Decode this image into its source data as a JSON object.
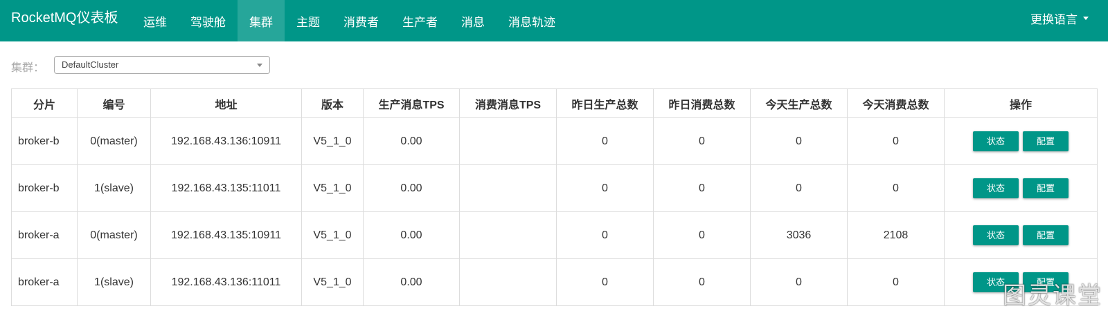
{
  "navbar": {
    "brand": "RocketMQ仪表板",
    "items": [
      {
        "label": "运维",
        "active": false
      },
      {
        "label": "驾驶舱",
        "active": false
      },
      {
        "label": "集群",
        "active": true
      },
      {
        "label": "主题",
        "active": false
      },
      {
        "label": "消费者",
        "active": false
      },
      {
        "label": "生产者",
        "active": false
      },
      {
        "label": "消息",
        "active": false
      },
      {
        "label": "消息轨迹",
        "active": false
      }
    ],
    "language": "更换语言"
  },
  "cluster": {
    "label": "集群：",
    "selected": "DefaultCluster"
  },
  "table": {
    "headers": [
      "分片",
      "编号",
      "地址",
      "版本",
      "生产消息TPS",
      "消费消息TPS",
      "昨日生产总数",
      "昨日消费总数",
      "今天生产总数",
      "今天消费总数",
      "操作"
    ],
    "rows": [
      {
        "name": "broker-b",
        "id": "0(master)",
        "address": "192.168.43.136:10911",
        "version": "V5_1_0",
        "produce_tps": "0.00",
        "consume_tps": "",
        "yesterday_produce": "0",
        "yesterday_consume": "0",
        "today_produce": "0",
        "today_consume": "0"
      },
      {
        "name": "broker-b",
        "id": "1(slave)",
        "address": "192.168.43.135:11011",
        "version": "V5_1_0",
        "produce_tps": "0.00",
        "consume_tps": "",
        "yesterday_produce": "0",
        "yesterday_consume": "0",
        "today_produce": "0",
        "today_consume": "0"
      },
      {
        "name": "broker-a",
        "id": "0(master)",
        "address": "192.168.43.135:10911",
        "version": "V5_1_0",
        "produce_tps": "0.00",
        "consume_tps": "",
        "yesterday_produce": "0",
        "yesterday_consume": "0",
        "today_produce": "3036",
        "today_consume": "2108"
      },
      {
        "name": "broker-a",
        "id": "1(slave)",
        "address": "192.168.43.136:11011",
        "version": "V5_1_0",
        "produce_tps": "0.00",
        "consume_tps": "",
        "yesterday_produce": "0",
        "yesterday_consume": "0",
        "today_produce": "0",
        "today_consume": "0"
      }
    ],
    "status_button": "状态",
    "config_button": "配置"
  },
  "watermark": "图灵课堂",
  "colors": {
    "primary": "#009688",
    "nav_active": "#26a69a"
  }
}
